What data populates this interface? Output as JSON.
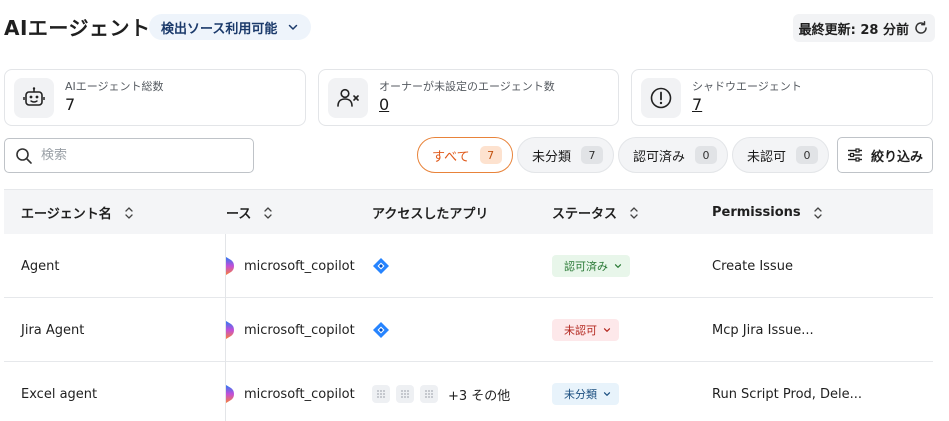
{
  "header": {
    "title": "AIエージェント",
    "source_filter": "検出ソース利用可能",
    "last_updated": "最終更新: 28 分前"
  },
  "summary_cards": [
    {
      "label": "AIエージェント総数",
      "value": "7",
      "icon": "robot-icon"
    },
    {
      "label": "オーナーが未設定のエージェント数",
      "value": "0",
      "icon": "user-x-icon"
    },
    {
      "label": "シャドウエージェント",
      "value": "7",
      "icon": "alert-circle-icon"
    }
  ],
  "search": {
    "placeholder": "検索",
    "value": ""
  },
  "filter_chips": [
    {
      "label": "すべて",
      "count": "7",
      "active": true
    },
    {
      "label": "未分類",
      "count": "7",
      "active": false
    },
    {
      "label": "認可済み",
      "count": "0",
      "active": false
    },
    {
      "label": "未認可",
      "count": "0",
      "active": false
    }
  ],
  "filter_button": "絞り込み",
  "table": {
    "columns": [
      "エージェント名",
      "ース",
      "アクセスしたアプリ",
      "ステータス",
      "Permissions"
    ],
    "rows": [
      {
        "name": "Agent",
        "source": "microsoft_copilot",
        "apps": "jira",
        "more": "",
        "status": "認可済み",
        "status_type": "approved",
        "permissions": "Create Issue"
      },
      {
        "name": "Jira Agent",
        "source": "microsoft_copilot",
        "apps": "jira",
        "more": "",
        "status": "未認可",
        "status_type": "unapproved",
        "permissions": "Mcp Jira Issue..."
      },
      {
        "name": "Excel agent",
        "source": "microsoft_copilot",
        "apps": "tiles",
        "more": "+3 その他",
        "status": "未分類",
        "status_type": "uncat",
        "permissions": "Run Script Prod, Dele..."
      }
    ]
  },
  "colors": {
    "accent_orange": "#e05a1b",
    "approved_green": "#2a7a36",
    "unapproved_red": "#b3261e",
    "uncategorized_blue": "#1b4f80",
    "jira_blue": "#2684ff"
  }
}
